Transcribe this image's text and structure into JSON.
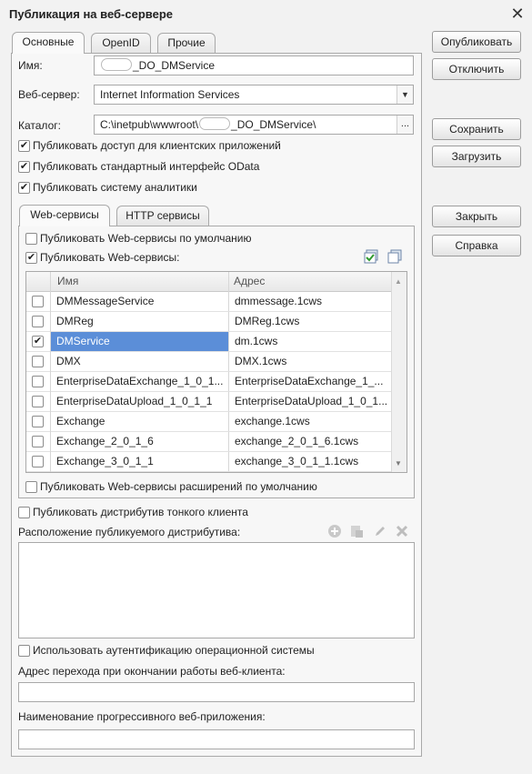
{
  "window": {
    "title": "Публикация на веб-сервере",
    "close_glyph": "✕"
  },
  "tabs": [
    {
      "label": "Основные",
      "active": true
    },
    {
      "label": "OpenID",
      "active": false
    },
    {
      "label": "Прочие",
      "active": false
    }
  ],
  "form": {
    "name_label": "Имя:",
    "name_value_suffix": "_DO_DMService",
    "server_label": "Веб-сервер:",
    "server_value": "Internet Information Services",
    "catalog_label": "Каталог:",
    "catalog_prefix": "C:\\inetpub\\wwwroot\\",
    "catalog_suffix": "_DO_DMService\\",
    "browse_label": "...",
    "publish_clients": {
      "label": "Публиковать доступ для клиентских приложений",
      "checked": true
    },
    "publish_odata": {
      "label": "Публиковать стандартный интерфейс OData",
      "checked": true
    },
    "publish_analytics": {
      "label": "Публиковать систему аналитики",
      "checked": true
    }
  },
  "inner_tabs": [
    {
      "label": "Web-сервисы",
      "active": true
    },
    {
      "label": "HTTP сервисы",
      "active": false
    }
  ],
  "web_services": {
    "default_label": "Публиковать Web-сервисы по умолчанию",
    "default_checked": false,
    "publish_label": "Публиковать Web-сервисы:",
    "publish_checked": true,
    "columns": {
      "name": "Имя",
      "address": "Адрес"
    },
    "rows": [
      {
        "checked": false,
        "name": "DMMessageService",
        "address": "dmmessage.1cws"
      },
      {
        "checked": false,
        "name": "DMReg",
        "address": "DMReg.1cws"
      },
      {
        "checked": true,
        "name": "DMService",
        "address": "dm.1cws"
      },
      {
        "checked": false,
        "name": "DMX",
        "address": "DMX.1cws"
      },
      {
        "checked": false,
        "name": "EnterpriseDataExchange_1_0_1...",
        "address": "EnterpriseDataExchange_1_..."
      },
      {
        "checked": false,
        "name": "EnterpriseDataUpload_1_0_1_1",
        "address": "EnterpriseDataUpload_1_0_1..."
      },
      {
        "checked": false,
        "name": "Exchange",
        "address": "exchange.1cws"
      },
      {
        "checked": false,
        "name": "Exchange_2_0_1_6",
        "address": "exchange_2_0_1_6.1cws"
      },
      {
        "checked": false,
        "name": "Exchange_3_0_1_1",
        "address": "exchange_3_0_1_1.1cws"
      }
    ],
    "ext_label": "Публиковать Web-сервисы расширений по умолчанию"
  },
  "thin_client": {
    "publish_label": "Публиковать дистрибутив тонкого клиента",
    "location_label": "Расположение публикуемого дистрибутива:"
  },
  "os_auth_label": "Использовать аутентификацию операционной системы",
  "exit_address_label": "Адрес перехода при окончании работы веб-клиента:",
  "pwa_name_label": "Наименование прогрессивного веб-приложения:",
  "buttons": {
    "publish": "Опубликовать",
    "disable": "Отключить",
    "save": "Сохранить",
    "load": "Загрузить",
    "close": "Закрыть",
    "help": "Справка"
  }
}
